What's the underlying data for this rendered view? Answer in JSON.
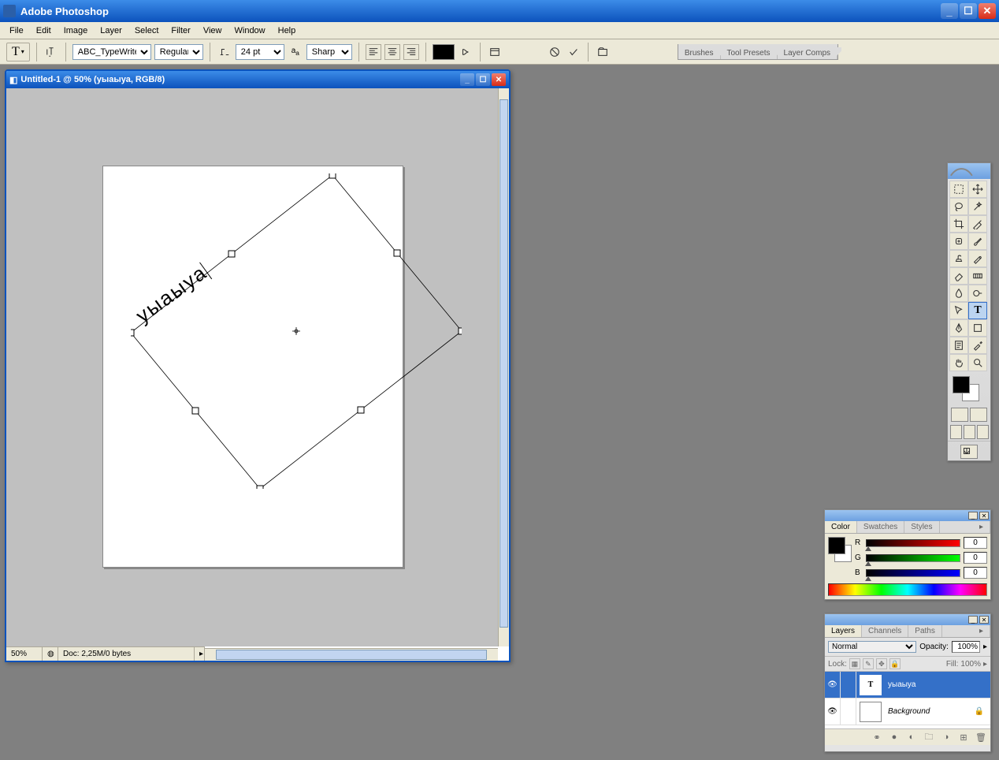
{
  "app": {
    "title": "Adobe Photoshop"
  },
  "menus": [
    "File",
    "Edit",
    "Image",
    "Layer",
    "Select",
    "Filter",
    "View",
    "Window",
    "Help"
  ],
  "options": {
    "font_family": "ABC_TypeWriter...",
    "font_style": "Regular",
    "font_size": "24 pt",
    "antialias": "Sharp"
  },
  "palette_tabs": [
    "Brushes",
    "Tool Presets",
    "Layer Comps"
  ],
  "document": {
    "title": "Untitled-1 @ 50% (уыаыуа, RGB/8)",
    "text_content": "уыаыуа",
    "zoom": "50%",
    "info": "Doc: 2,25M/0 bytes"
  },
  "color": {
    "tabs": [
      "Color",
      "Swatches",
      "Styles"
    ],
    "r_label": "R",
    "g_label": "G",
    "b_label": "B",
    "r": "0",
    "g": "0",
    "b": "0"
  },
  "layers": {
    "tabs": [
      "Layers",
      "Channels",
      "Paths"
    ],
    "blend_mode": "Normal",
    "opacity_label": "Opacity:",
    "opacity": "100%",
    "lock_label": "Lock:",
    "fill_label": "Fill:",
    "fill": "100%",
    "items": [
      {
        "name": "уыаыуа",
        "kind": "text"
      },
      {
        "name": "Background",
        "kind": "bg"
      }
    ]
  }
}
